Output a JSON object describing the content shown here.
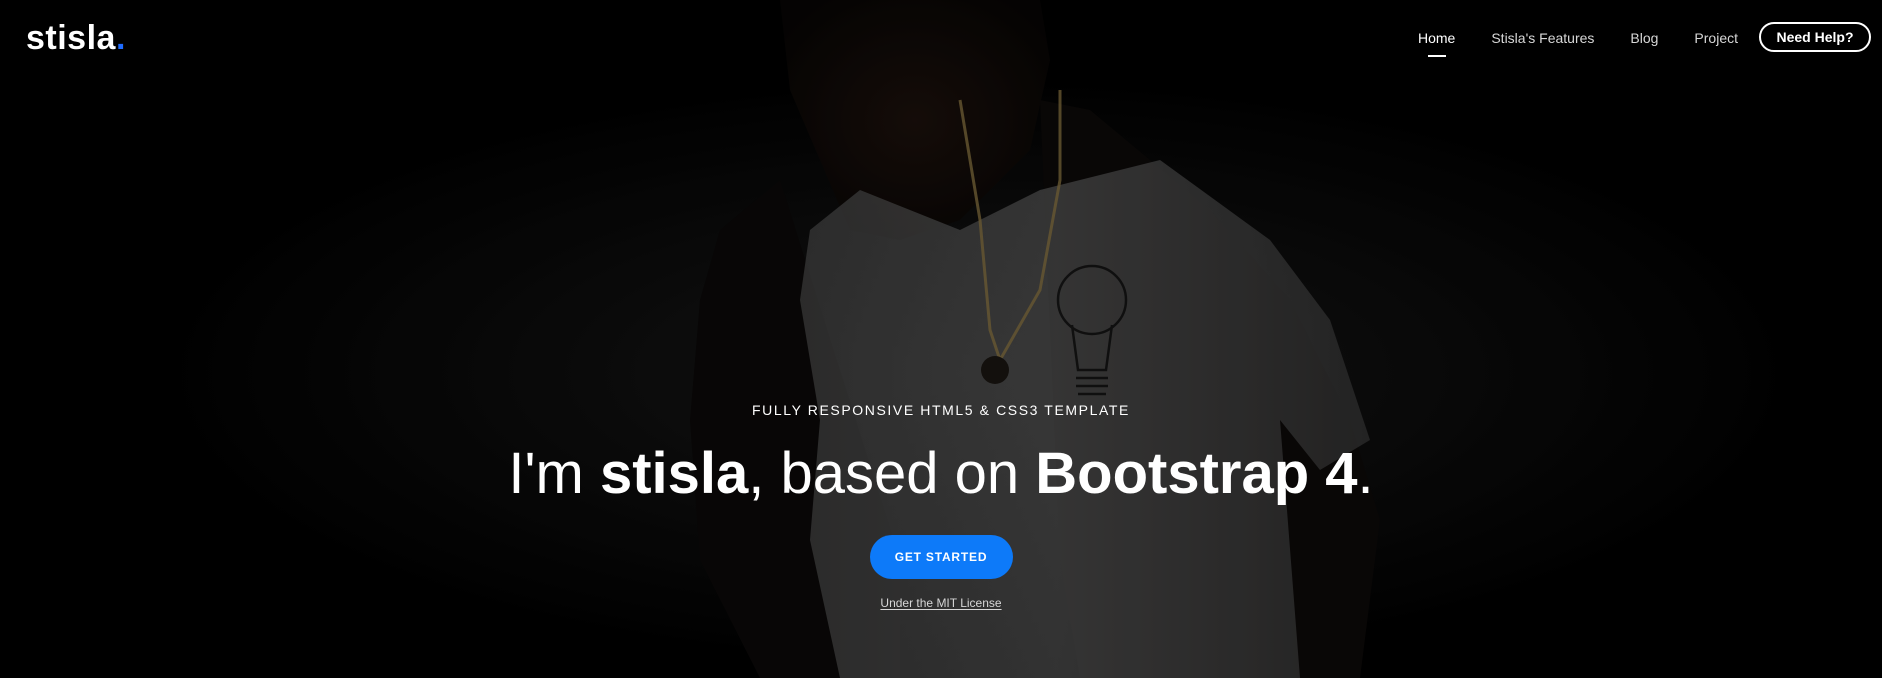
{
  "nav": {
    "logo_text": "stisla",
    "logo_dot": ".",
    "items": [
      {
        "label": "Home"
      },
      {
        "label": "Stisla's Features"
      },
      {
        "label": "Blog"
      },
      {
        "label": "Project"
      }
    ],
    "help_button": "Need Help?"
  },
  "hero": {
    "tagline": "FULLY RESPONSIVE HTML5 & CSS3 TEMPLATE",
    "headline": {
      "part1": "I'm ",
      "bold1": "stisla",
      "part2": ", based on ",
      "bold2": "Bootstrap 4",
      "part3": "."
    },
    "cta": "GET STARTED",
    "license": "Under the MIT License"
  },
  "colors": {
    "accent": "#0d7af9",
    "logo_dot": "#1e6bff",
    "background": "#000000"
  }
}
